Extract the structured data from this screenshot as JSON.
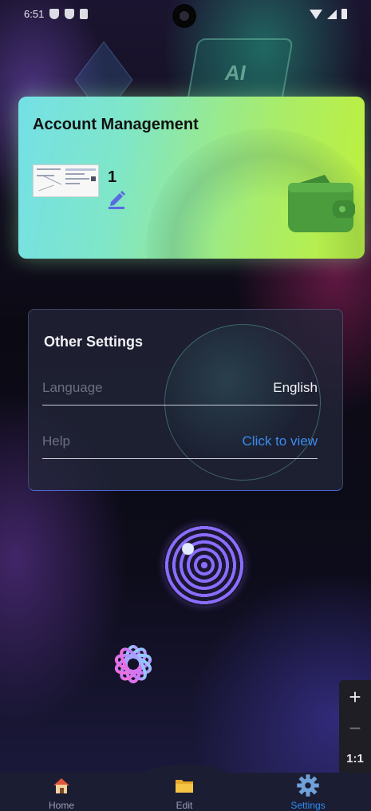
{
  "status_bar": {
    "time": "6:51"
  },
  "account_card": {
    "title": "Account Management",
    "account_number": "1"
  },
  "other_settings": {
    "title": "Other Settings",
    "language_label": "Language",
    "language_value": "English",
    "help_label": "Help",
    "help_link": "Click to view"
  },
  "zoom_control": {
    "plus": "+",
    "minus": "−",
    "ratio": "1:1"
  },
  "bottom_nav": {
    "items": [
      {
        "label": "Home",
        "icon": "home-icon"
      },
      {
        "label": "Edit",
        "icon": "folder-icon"
      },
      {
        "label": "Settings",
        "icon": "gear-icon"
      }
    ],
    "active": "Settings"
  },
  "colors": {
    "card_gradient_start": "#74e0e6",
    "card_gradient_end": "#bff03a",
    "link": "#3a8cf0",
    "active_nav": "#2f8cf5"
  }
}
